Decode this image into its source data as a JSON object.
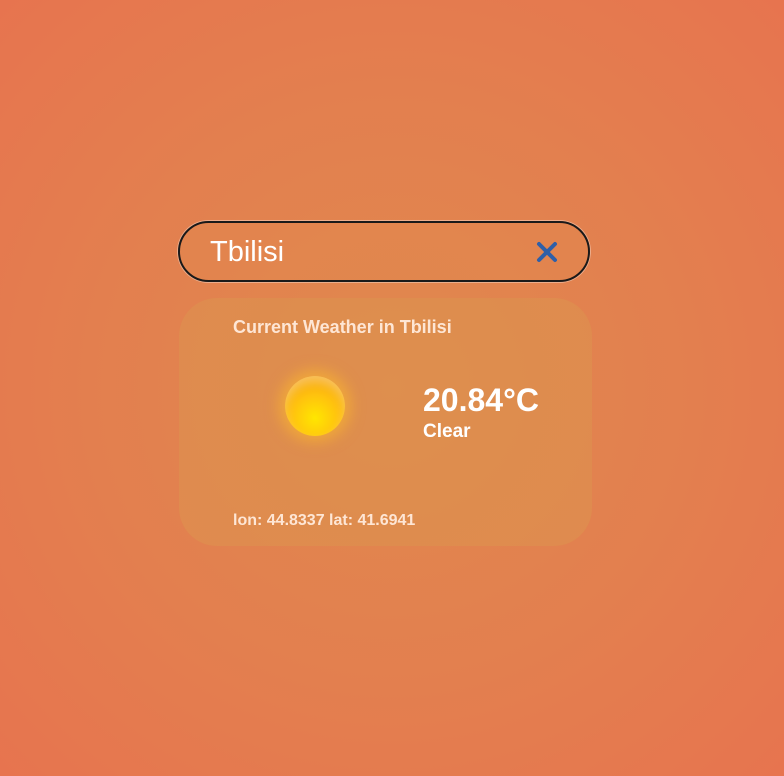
{
  "search": {
    "value": "Tbilisi",
    "clear_icon": "close-icon"
  },
  "weather": {
    "title": "Current Weather in Tbilisi",
    "icon": "sun-icon",
    "temperature": "20.84°C",
    "condition": "Clear",
    "coordinates": "lon: 44.8337 lat: 41.6941"
  },
  "colors": {
    "background": "#e37f4f",
    "clear_icon": "#2f5fa8",
    "card_text": "#ffffff"
  }
}
